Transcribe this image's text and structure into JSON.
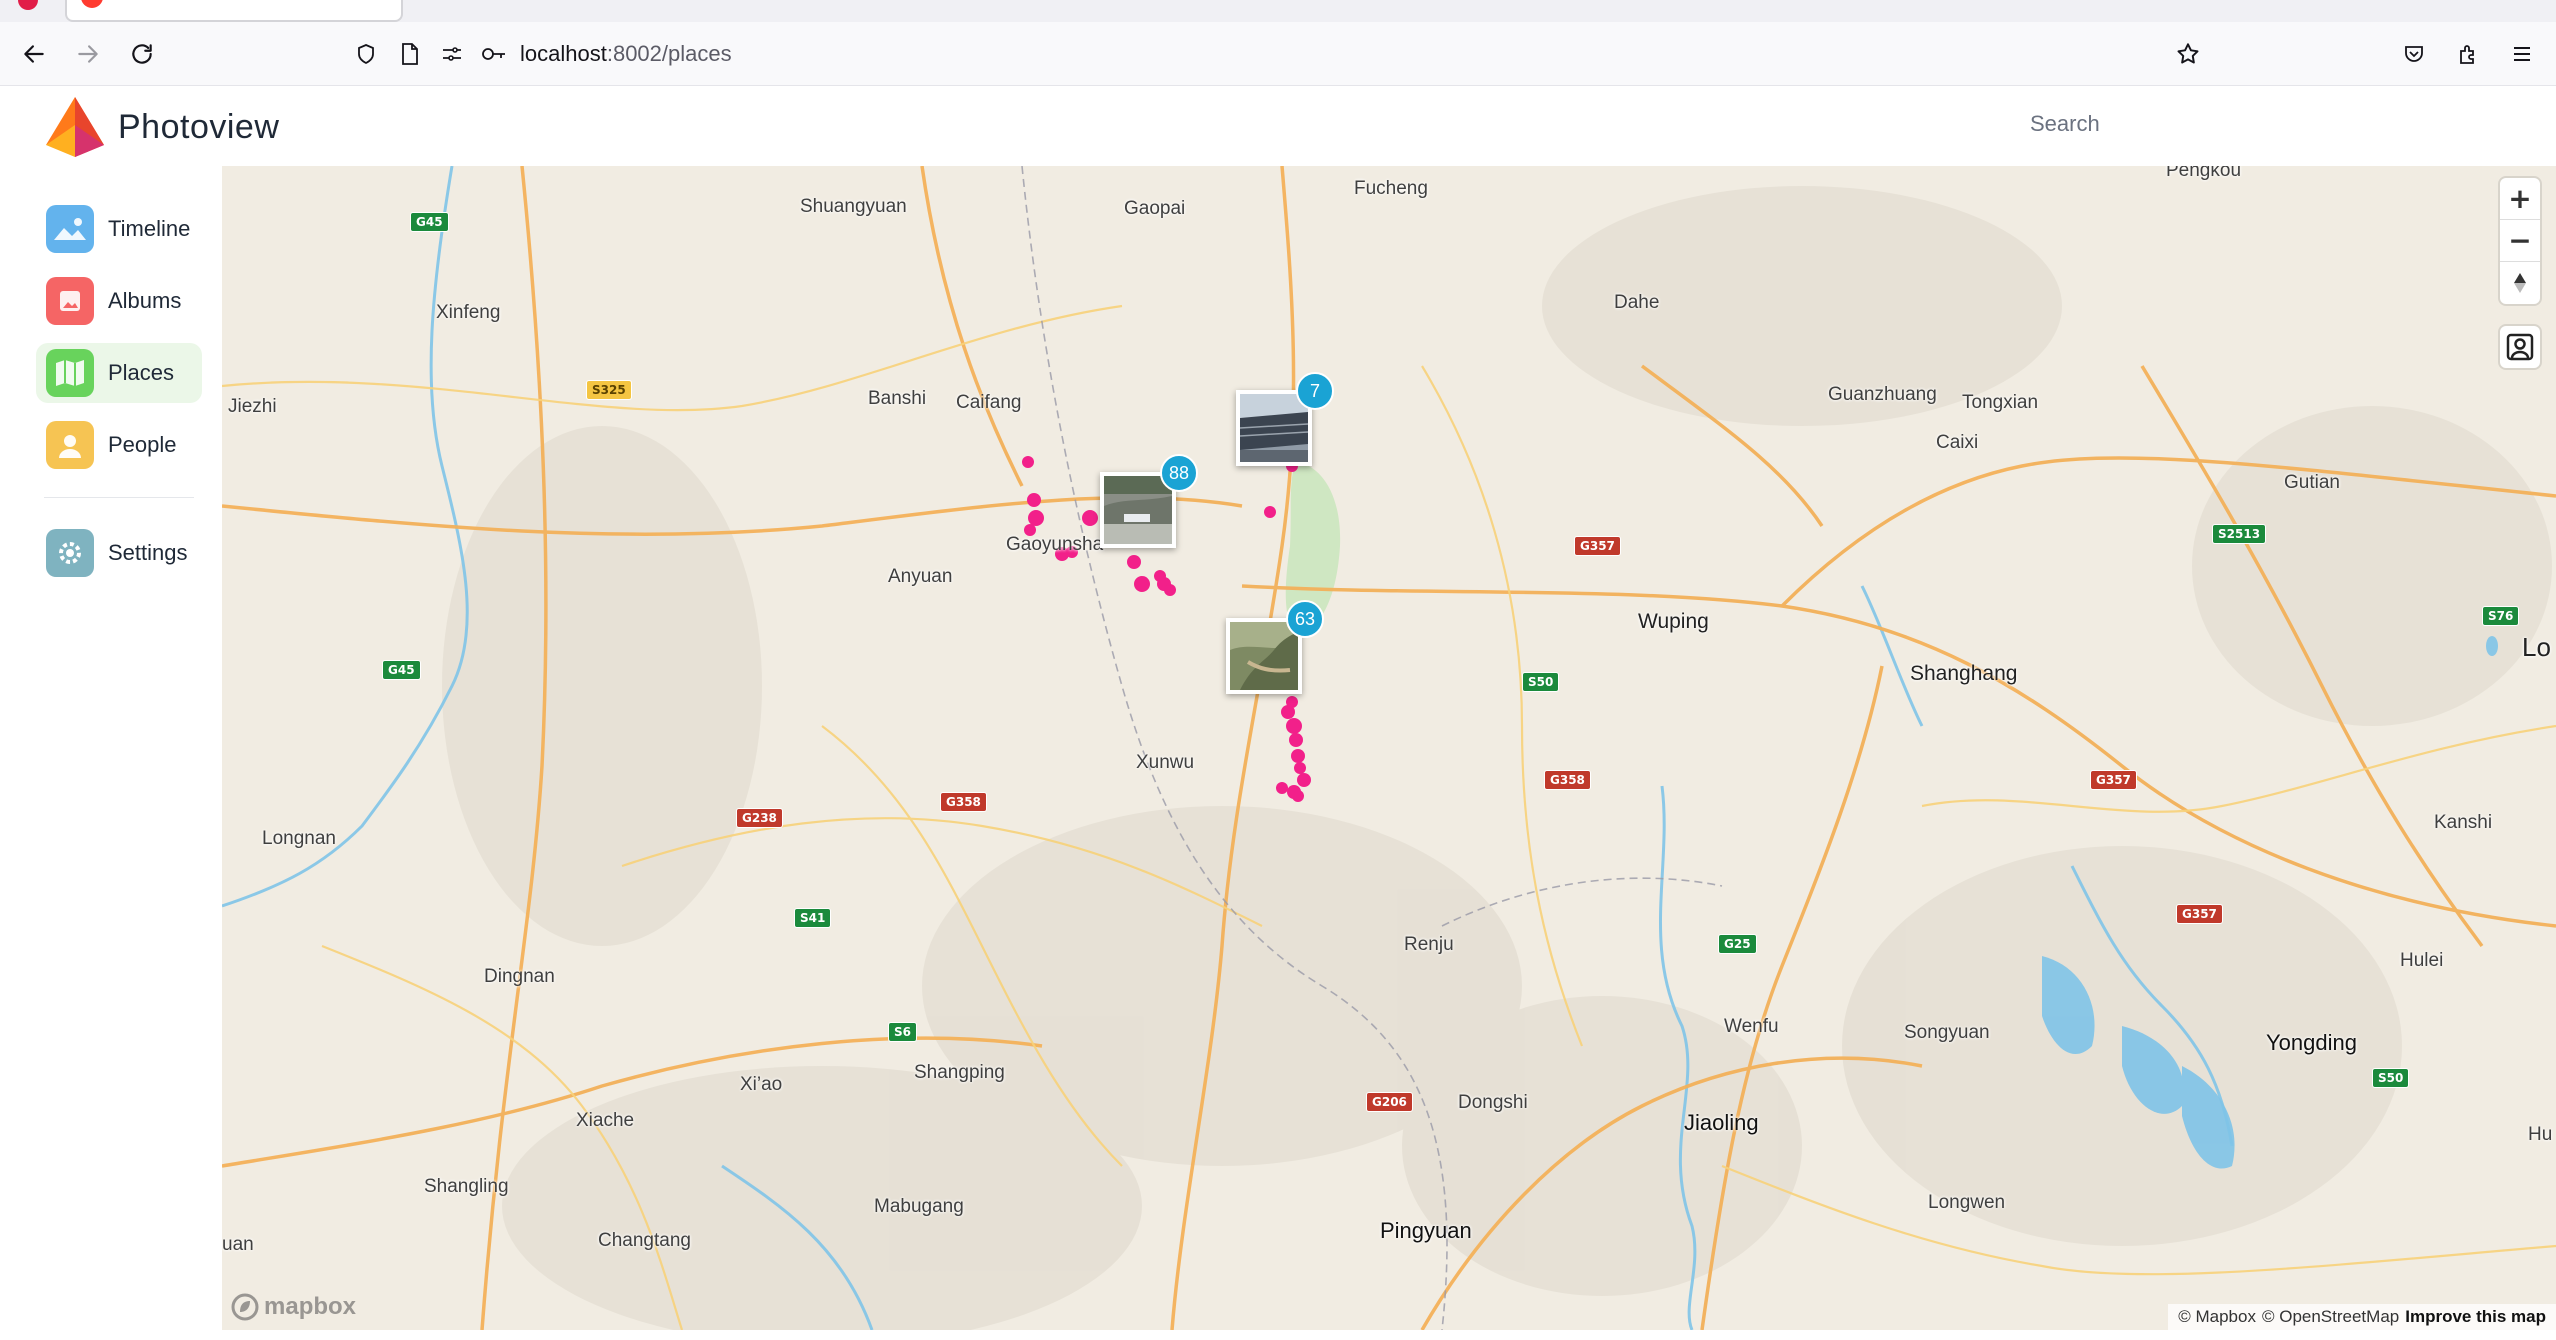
{
  "browser": {
    "url_host": "localhost",
    "url_path": ":8002/places"
  },
  "app": {
    "brand": "Photoview",
    "search_placeholder": "Search"
  },
  "sidebar": {
    "items": [
      {
        "label": "Timeline",
        "icon": "timeline-icon",
        "color": "#63b3ed"
      },
      {
        "label": "Albums",
        "icon": "albums-icon",
        "color": "#f56565"
      },
      {
        "label": "Places",
        "icon": "places-icon",
        "color": "#68d35c",
        "active": true
      },
      {
        "label": "People",
        "icon": "people-icon",
        "color": "#f6c453"
      },
      {
        "label": "Settings",
        "icon": "settings-icon",
        "color": "#7fb3c0"
      }
    ]
  },
  "map": {
    "places": {
      "shuangyuan": "Shuangyuan",
      "gaopai": "Gaopai",
      "fucheng": "Fucheng",
      "pengkou": "Pengkou",
      "xinfeng": "Xinfeng",
      "dahe": "Dahe",
      "jiezhi": "Jiezhi",
      "banshi": "Banshi",
      "caifang": "Caifang",
      "guanzhuang": "Guanzhuang",
      "tongxian": "Tongxian",
      "caixi": "Caixi",
      "gutian": "Gutian",
      "gaoyunsha": "Gaoyunsha",
      "anyuan": "Anyuan",
      "wuping": "Wuping",
      "shanghang": "Shanghang",
      "lo": "Lo",
      "xunwu": "Xunwu",
      "longnan": "Longnan",
      "kanshi": "Kanshi",
      "renju": "Renju",
      "dingnan": "Dingnan",
      "hulei": "Hulei",
      "wenfu": "Wenfu",
      "songyuan": "Songyuan",
      "yongding": "Yongding",
      "xiao": "Xi’ao",
      "shangping": "Shangping",
      "xiache": "Xiache",
      "dongshi": "Dongshi",
      "jiaoling": "Jiaoling",
      "hu": "Hu",
      "shangling": "Shangling",
      "mabugang": "Mabugang",
      "longwen": "Longwen",
      "pingyuan": "Pingyuan",
      "changtang": "Changtang",
      "uan": "uan"
    },
    "shields": {
      "g45a": "G45",
      "s325": "S325",
      "g357a": "G357",
      "s2513": "S2513",
      "s76": "S76",
      "g45b": "G45",
      "s50a": "S50",
      "g358a": "G358",
      "g357b": "G357",
      "g238": "G238",
      "g358b": "G358",
      "s41": "S41",
      "g25": "G25",
      "g357c": "G357",
      "s6": "S6",
      "g206": "G206",
      "s50b": "S50"
    },
    "clusters": [
      {
        "count": "7"
      },
      {
        "count": "88"
      },
      {
        "count": "63"
      }
    ],
    "controls": {
      "zoom_in": "+",
      "zoom_out": "−"
    },
    "attribution": {
      "mapbox": "© Mapbox",
      "osm": "© OpenStreetMap",
      "improve": "Improve this map"
    },
    "logo": "mapbox"
  }
}
